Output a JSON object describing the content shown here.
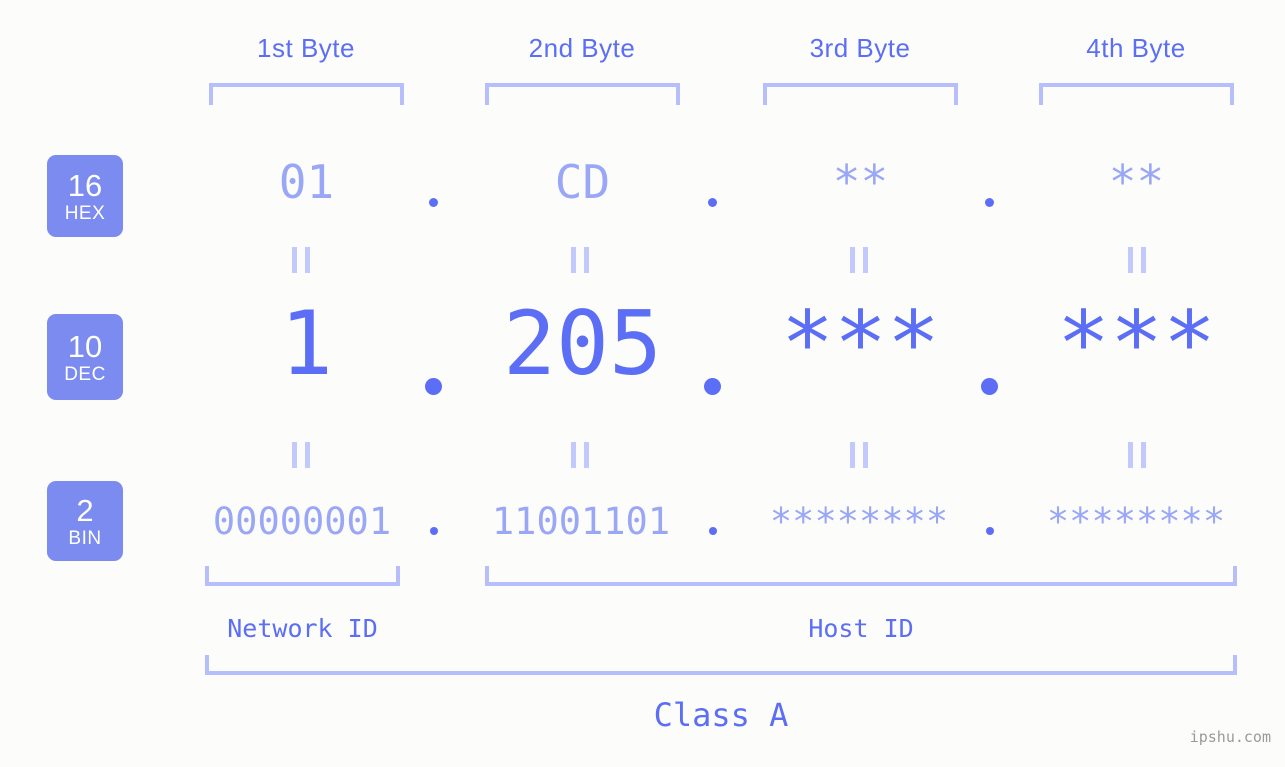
{
  "meta": {
    "watermark": "ipshu.com",
    "background_color": "#fcfdfa",
    "accent_color": "#5b6ef5",
    "accent_light_color": "#9aa7f7",
    "bracket_color": "#b6bffb",
    "badge_color": "#7b8bf0"
  },
  "headers": {
    "byte1": "1st Byte",
    "byte2": "2nd Byte",
    "byte3": "3rd Byte",
    "byte4": "4th Byte"
  },
  "bases": {
    "hex": {
      "number": "16",
      "name": "HEX"
    },
    "dec": {
      "number": "10",
      "name": "DEC"
    },
    "bin": {
      "number": "2",
      "name": "BIN"
    }
  },
  "rows": {
    "hex": {
      "values": [
        "01",
        "CD",
        "**",
        "**"
      ],
      "separator": "."
    },
    "dec": {
      "values": [
        "1",
        "205",
        "***",
        "***"
      ],
      "separator": "."
    },
    "bin": {
      "values": [
        "00000001",
        "11001101",
        "********",
        "********"
      ],
      "separator": "."
    }
  },
  "equals_symbol": "=",
  "sections": {
    "network_id": "Network ID",
    "host_id": "Host ID",
    "class": "Class A"
  }
}
